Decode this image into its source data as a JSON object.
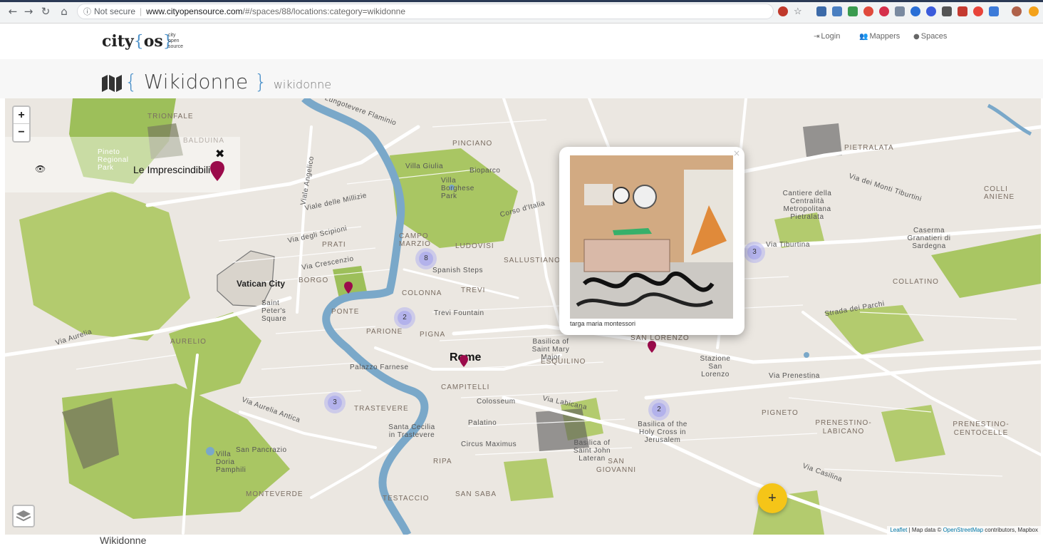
{
  "browser": {
    "security_label": "Not secure",
    "url_host": "www.cityopensource.com",
    "url_path": "/#/spaces/88/locations:category=wikidonne"
  },
  "header": {
    "logo_city": "city",
    "logo_os": "os",
    "logo_sub": [
      "city",
      "open",
      "source"
    ],
    "nav": {
      "login": "Login",
      "mappers": "Mappers",
      "spaces": "Spaces"
    }
  },
  "page": {
    "title": "Wikidonne",
    "slug": "wikidonne"
  },
  "map": {
    "zoom_in": "+",
    "zoom_out": "−",
    "legend": {
      "label": "Le Imprescindibili",
      "close": "✖"
    },
    "districts": [
      "TRIONFALE",
      "BALDUINA",
      "PINCIANO",
      "PRATI",
      "CAMPO MARZIO",
      "LUDOVISI",
      "SALLUSTIANO",
      "BORGO",
      "COLONNA",
      "TREVI",
      "PONTE",
      "PARIONE",
      "PIGNA",
      "AURELIO",
      "ESQUILINO",
      "CAMPITELLI",
      "TRASTEVERE",
      "RIPA",
      "SAN GIOVANNI",
      "MONTEVERDE",
      "TESTACCIO",
      "SAN SABA",
      "PIETRALATA",
      "COLLATINO",
      "PIGNETO",
      "PRENESTINO-LABICANO",
      "PRENESTINO-CENTOCELLE",
      "SAN LORENZO",
      "COLLI ANIENE"
    ],
    "places": {
      "vatican": "Vatican City",
      "rome": "Rome",
      "villa_borghese": "Villa Borghese Park",
      "villa_giulia": "Villa Giulia",
      "bioparco": "Bioparco",
      "spanish_steps": "Spanish Steps",
      "trevi_fountain": "Trevi Fountain",
      "colosseum": "Colosseum",
      "circus_maximus": "Circus Maximus",
      "palatino": "Palatino",
      "villa_doria": "Villa Doria Pamphili",
      "san_pancrazio": "San Pancrazio",
      "saint_peters": "Saint Peter's Square",
      "basilica_mary": "Basilica of Saint Mary Major",
      "palazzo_farnese": "Palazzo Farnese",
      "pineto": "Pineto Regional Park",
      "stazione": "Stazione San Lorenzo",
      "santa_cecilia": "Santa Cecilia in Trastevere",
      "holy_cross": "Basilica of the Holy Cross in Jerusalem",
      "john_lateran": "Basilica of Saint John Lateran",
      "caserma": "Caserma Granatieri di Sardegna",
      "cantiere": "Cantiere della Centralità Metropolitana Pietralata"
    },
    "roads": {
      "viale_milizie": "Viale delle Millizie",
      "via_scipioni": "Via degli Scipioni",
      "via_crescenzio": "Via Crescenzio",
      "via_aurelia": "Via Aurelia",
      "via_aurelia_antica": "Via Aurelia Antica",
      "via_tiburtina": "Via Tiburtina",
      "via_prenestina": "Via Prenestina",
      "via_casilina": "Via Casilina",
      "via_labicana": "Via Labicana",
      "strada_parchi": "Strada dei Parchi",
      "corso_italia": "Corso d'Italia",
      "lungotevere": "Lungotevere Flaminio",
      "via_monti_tiburtini": "Via dei Monti Tiburtini",
      "viale_angelico": "Viale Angelico"
    },
    "clusters": [
      {
        "count": "8"
      },
      {
        "count": "2"
      },
      {
        "count": "3"
      },
      {
        "count": "2"
      },
      {
        "count": "3"
      }
    ],
    "popup": {
      "caption": "targa maria montessori",
      "close": "×"
    },
    "add_button": "+",
    "attribution": {
      "leaflet": "Leaflet",
      "text1": " | Map data © ",
      "osm": "OpenStreetMap",
      "text2": " contributors, Mapbox"
    }
  },
  "footer": {
    "title": "Wikidonne"
  }
}
